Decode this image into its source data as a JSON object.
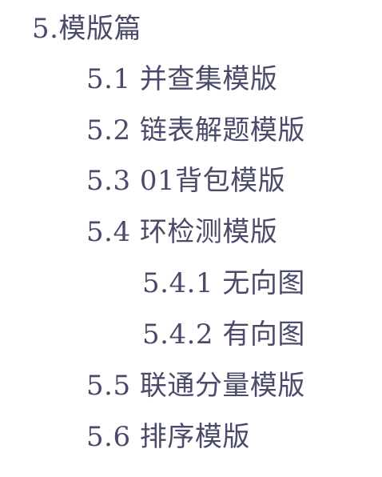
{
  "toc": {
    "items": [
      {
        "label": "5.模版篇"
      },
      {
        "label": "5.1 并查集模版"
      },
      {
        "label": "5.2 链表解题模版"
      },
      {
        "label": "5.3 01背包模版"
      },
      {
        "label": "5.4 环检测模版"
      },
      {
        "label": "5.4.1 无向图"
      },
      {
        "label": "5.4.2 有向图"
      },
      {
        "label": "5.5 联通分量模版"
      },
      {
        "label": "5.6 排序模版"
      }
    ]
  },
  "colors": {
    "text": "#4a4a6a",
    "background": "#ffffff"
  }
}
